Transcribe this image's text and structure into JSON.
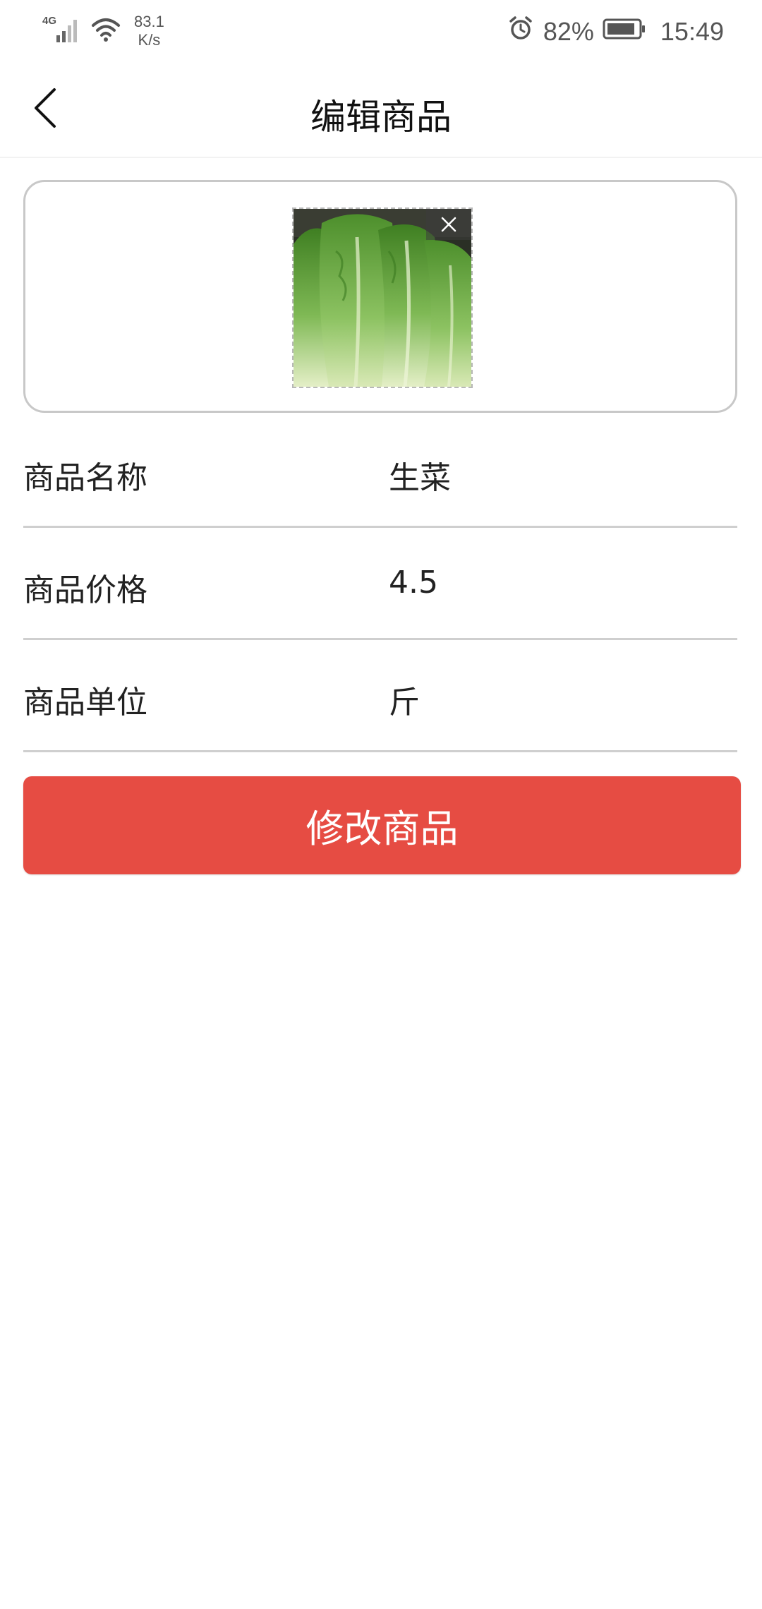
{
  "status_bar": {
    "network_type": "4G",
    "speed_value": "83.1",
    "speed_unit": "K/s",
    "battery_percent": "82%",
    "time": "15:49",
    "icons": [
      "signal-icon",
      "wifi-icon",
      "alarm-icon",
      "battery-icon"
    ]
  },
  "header": {
    "title": "编辑商品",
    "back_icon": "chevron-left-icon"
  },
  "image_upload": {
    "image_subject": "lettuce",
    "remove_icon": "close-icon"
  },
  "form": {
    "fields": [
      {
        "label": "商品名称",
        "value": "生菜"
      },
      {
        "label": "商品价格",
        "value": "4.5"
      },
      {
        "label": "商品单位",
        "value": "斤"
      }
    ]
  },
  "actions": {
    "submit_label": "修改商品"
  },
  "colors": {
    "primary_button": "#e64c43",
    "divider": "#cfcfcf",
    "card_border": "#c8c8c8"
  }
}
